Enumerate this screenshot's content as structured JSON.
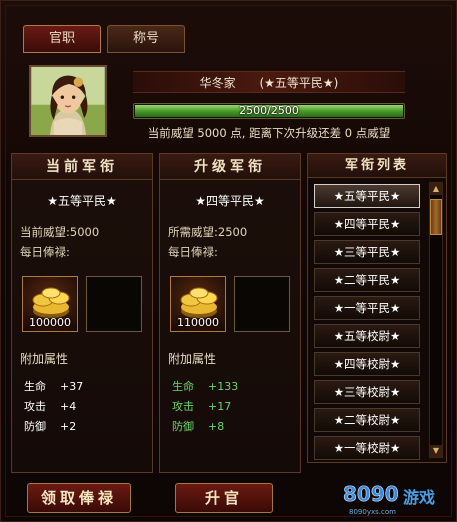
{
  "tabs": [
    {
      "label": "官职"
    },
    {
      "label": "称号"
    }
  ],
  "player": {
    "name": "华冬家",
    "rank": "(★五等平民★)"
  },
  "prestige_bar": {
    "text": "2500/2500",
    "fill_fraction": 1.0
  },
  "prestige_line": "当前威望 5000 点, 距离下次升级还差 0 点威望",
  "current": {
    "header": "当前军衔",
    "title": "★五等平民★",
    "prestige_line": "当前威望:5000",
    "salary_label": "每日俸禄:",
    "salary_qty": "100000",
    "attr_header": "附加属性",
    "attrs": [
      {
        "k": "生命",
        "v": "+37"
      },
      {
        "k": "攻击",
        "v": "+4"
      },
      {
        "k": "防御",
        "v": "+2"
      }
    ]
  },
  "upgrade": {
    "header": "升级军衔",
    "title": "★四等平民★",
    "prestige_line": "所需威望:2500",
    "salary_label": "每日俸禄:",
    "salary_qty": "110000",
    "attr_header": "附加属性",
    "attrs": [
      {
        "k": "生命",
        "v": "+133"
      },
      {
        "k": "攻击",
        "v": "+17"
      },
      {
        "k": "防御",
        "v": "+8"
      }
    ]
  },
  "rank_list": {
    "header": "军衔列表",
    "items": [
      "★五等平民★",
      "★四等平民★",
      "★三等平民★",
      "★二等平民★",
      "★一等平民★",
      "★五等校尉★",
      "★四等校尉★",
      "★三等校尉★",
      "★二等校尉★",
      "★一等校尉★"
    ],
    "selected_index": 0
  },
  "buttons": {
    "claim": "领取俸禄",
    "promote": "升官"
  },
  "logo": {
    "main": "8090",
    "tag": "游戏",
    "url": "8090yxs.com"
  },
  "colors": {
    "accent_red": "#6a1a12",
    "bonus_green": "#6cd66a",
    "xp_green": "#4a9a2a"
  }
}
